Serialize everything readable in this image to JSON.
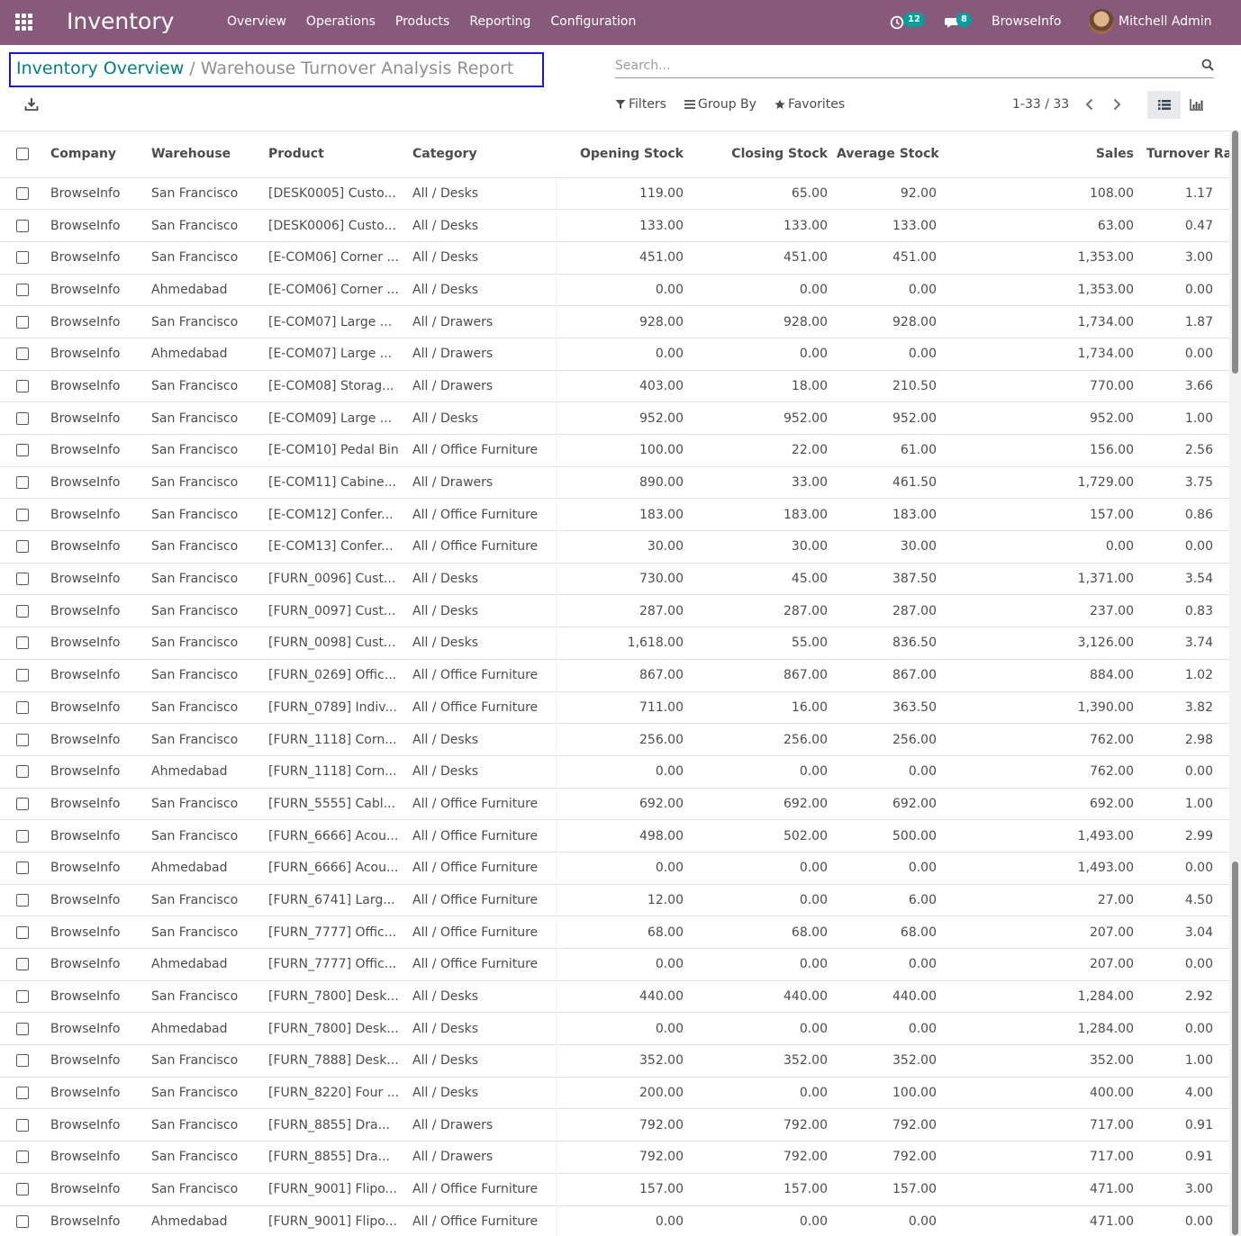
{
  "navbar": {
    "app_name": "Inventory",
    "menu": [
      "Overview",
      "Operations",
      "Products",
      "Reporting",
      "Configuration"
    ],
    "activity_count": "12",
    "message_count": "8",
    "company": "BrowseInfo",
    "user": "Mitchell Admin",
    "brand_color": "#875a7b"
  },
  "breadcrumb": {
    "parent": "Inventory Overview",
    "separator": "/",
    "current": "Warehouse Turnover Analysis Report"
  },
  "search": {
    "placeholder": "Search..."
  },
  "filters": {
    "filters_label": "Filters",
    "groupby_label": "Group By",
    "favorites_label": "Favorites"
  },
  "pager": {
    "text": "1-33 / 33"
  },
  "table": {
    "columns": [
      "Company",
      "Warehouse",
      "Product",
      "Category",
      "Opening Stock",
      "Closing Stock",
      "Average Stock",
      "Sales",
      "Turnover Ratio"
    ],
    "rows": [
      [
        "BrowseInfo",
        "San Francisco",
        "[DESK0005] Custo...",
        "All / Desks",
        "119.00",
        "65.00",
        "92.00",
        "108.00",
        "1.17"
      ],
      [
        "BrowseInfo",
        "San Francisco",
        "[DESK0006] Custo...",
        "All / Desks",
        "133.00",
        "133.00",
        "133.00",
        "63.00",
        "0.47"
      ],
      [
        "BrowseInfo",
        "San Francisco",
        "[E-COM06] Corner ...",
        "All / Desks",
        "451.00",
        "451.00",
        "451.00",
        "1,353.00",
        "3.00"
      ],
      [
        "BrowseInfo",
        "Ahmedabad",
        "[E-COM06] Corner ...",
        "All / Desks",
        "0.00",
        "0.00",
        "0.00",
        "1,353.00",
        "0.00"
      ],
      [
        "BrowseInfo",
        "San Francisco",
        "[E-COM07] Large ...",
        "All / Drawers",
        "928.00",
        "928.00",
        "928.00",
        "1,734.00",
        "1.87"
      ],
      [
        "BrowseInfo",
        "Ahmedabad",
        "[E-COM07] Large ...",
        "All / Drawers",
        "0.00",
        "0.00",
        "0.00",
        "1,734.00",
        "0.00"
      ],
      [
        "BrowseInfo",
        "San Francisco",
        "[E-COM08] Storag...",
        "All / Drawers",
        "403.00",
        "18.00",
        "210.50",
        "770.00",
        "3.66"
      ],
      [
        "BrowseInfo",
        "San Francisco",
        "[E-COM09] Large ...",
        "All / Desks",
        "952.00",
        "952.00",
        "952.00",
        "952.00",
        "1.00"
      ],
      [
        "BrowseInfo",
        "San Francisco",
        "[E-COM10] Pedal Bin",
        "All / Office Furniture",
        "100.00",
        "22.00",
        "61.00",
        "156.00",
        "2.56"
      ],
      [
        "BrowseInfo",
        "San Francisco",
        "[E-COM11] Cabine...",
        "All / Drawers",
        "890.00",
        "33.00",
        "461.50",
        "1,729.00",
        "3.75"
      ],
      [
        "BrowseInfo",
        "San Francisco",
        "[E-COM12] Confer...",
        "All / Office Furniture",
        "183.00",
        "183.00",
        "183.00",
        "157.00",
        "0.86"
      ],
      [
        "BrowseInfo",
        "San Francisco",
        "[E-COM13] Confer...",
        "All / Office Furniture",
        "30.00",
        "30.00",
        "30.00",
        "0.00",
        "0.00"
      ],
      [
        "BrowseInfo",
        "San Francisco",
        "[FURN_0096] Cust...",
        "All / Desks",
        "730.00",
        "45.00",
        "387.50",
        "1,371.00",
        "3.54"
      ],
      [
        "BrowseInfo",
        "San Francisco",
        "[FURN_0097] Cust...",
        "All / Desks",
        "287.00",
        "287.00",
        "287.00",
        "237.00",
        "0.83"
      ],
      [
        "BrowseInfo",
        "San Francisco",
        "[FURN_0098] Cust...",
        "All / Desks",
        "1,618.00",
        "55.00",
        "836.50",
        "3,126.00",
        "3.74"
      ],
      [
        "BrowseInfo",
        "San Francisco",
        "[FURN_0269] Offic...",
        "All / Office Furniture",
        "867.00",
        "867.00",
        "867.00",
        "884.00",
        "1.02"
      ],
      [
        "BrowseInfo",
        "San Francisco",
        "[FURN_0789] Indiv...",
        "All / Office Furniture",
        "711.00",
        "16.00",
        "363.50",
        "1,390.00",
        "3.82"
      ],
      [
        "BrowseInfo",
        "San Francisco",
        "[FURN_1118] Corn...",
        "All / Desks",
        "256.00",
        "256.00",
        "256.00",
        "762.00",
        "2.98"
      ],
      [
        "BrowseInfo",
        "Ahmedabad",
        "[FURN_1118] Corn...",
        "All / Desks",
        "0.00",
        "0.00",
        "0.00",
        "762.00",
        "0.00"
      ],
      [
        "BrowseInfo",
        "San Francisco",
        "[FURN_5555] Cabl...",
        "All / Office Furniture",
        "692.00",
        "692.00",
        "692.00",
        "692.00",
        "1.00"
      ],
      [
        "BrowseInfo",
        "San Francisco",
        "[FURN_6666] Acou...",
        "All / Office Furniture",
        "498.00",
        "502.00",
        "500.00",
        "1,493.00",
        "2.99"
      ],
      [
        "BrowseInfo",
        "Ahmedabad",
        "[FURN_6666] Acou...",
        "All / Office Furniture",
        "0.00",
        "0.00",
        "0.00",
        "1,493.00",
        "0.00"
      ],
      [
        "BrowseInfo",
        "San Francisco",
        "[FURN_6741] Larg...",
        "All / Office Furniture",
        "12.00",
        "0.00",
        "6.00",
        "27.00",
        "4.50"
      ],
      [
        "BrowseInfo",
        "San Francisco",
        "[FURN_7777] Offic...",
        "All / Office Furniture",
        "68.00",
        "68.00",
        "68.00",
        "207.00",
        "3.04"
      ],
      [
        "BrowseInfo",
        "Ahmedabad",
        "[FURN_7777] Offic...",
        "All / Office Furniture",
        "0.00",
        "0.00",
        "0.00",
        "207.00",
        "0.00"
      ],
      [
        "BrowseInfo",
        "San Francisco",
        "[FURN_7800] Desk...",
        "All / Desks",
        "440.00",
        "440.00",
        "440.00",
        "1,284.00",
        "2.92"
      ],
      [
        "BrowseInfo",
        "Ahmedabad",
        "[FURN_7800] Desk...",
        "All / Desks",
        "0.00",
        "0.00",
        "0.00",
        "1,284.00",
        "0.00"
      ],
      [
        "BrowseInfo",
        "San Francisco",
        "[FURN_7888] Desk...",
        "All / Desks",
        "352.00",
        "352.00",
        "352.00",
        "352.00",
        "1.00"
      ],
      [
        "BrowseInfo",
        "San Francisco",
        "[FURN_8220] Four ...",
        "All / Desks",
        "200.00",
        "0.00",
        "100.00",
        "400.00",
        "4.00"
      ],
      [
        "BrowseInfo",
        "San Francisco",
        "[FURN_8855] Dra...",
        "All / Drawers",
        "792.00",
        "792.00",
        "792.00",
        "717.00",
        "0.91"
      ],
      [
        "BrowseInfo",
        "San Francisco",
        "[FURN_8855] Dra...",
        "All / Drawers",
        "792.00",
        "792.00",
        "792.00",
        "717.00",
        "0.91"
      ],
      [
        "BrowseInfo",
        "San Francisco",
        "[FURN_9001] Flipo...",
        "All / Office Furniture",
        "157.00",
        "157.00",
        "157.00",
        "471.00",
        "3.00"
      ],
      [
        "BrowseInfo",
        "Ahmedabad",
        "[FURN_9001] Flipo...",
        "All / Office Furniture",
        "0.00",
        "0.00",
        "0.00",
        "471.00",
        "0.00"
      ]
    ]
  }
}
